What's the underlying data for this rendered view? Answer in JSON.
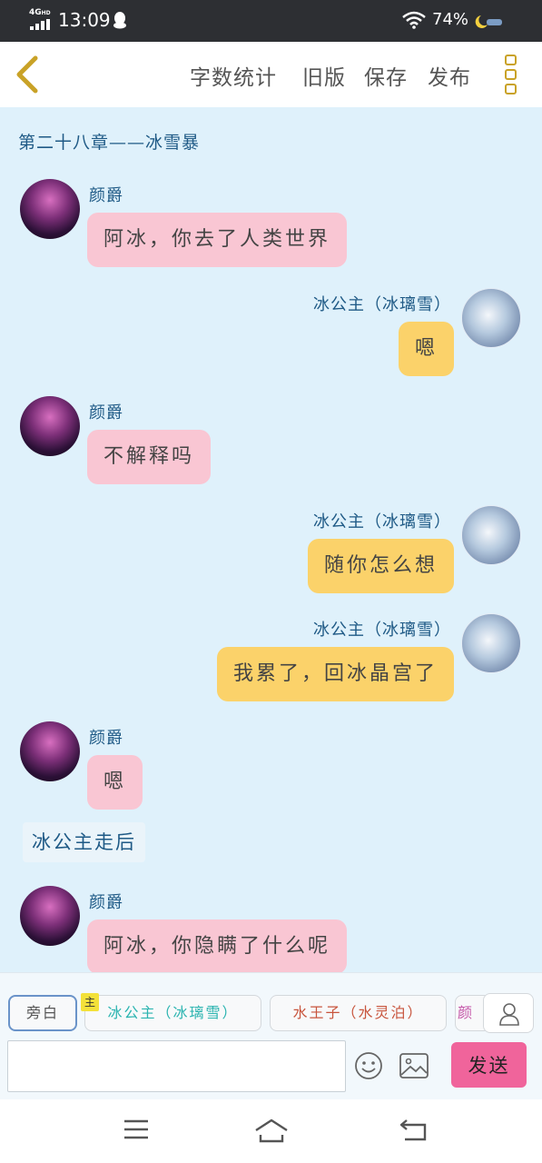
{
  "status_bar": {
    "network": "4G",
    "network_sup": "HD",
    "time": "13:09",
    "battery": "74%",
    "icons": [
      "signal-icon",
      "qq-icon",
      "wifi-icon",
      "moon-icon"
    ]
  },
  "header": {
    "links": [
      "字数统计",
      "旧版",
      "保存",
      "发布"
    ],
    "icons": [
      "back-arrow-icon",
      "more-menu-icon"
    ],
    "accent_color": "#c9a227"
  },
  "chat": {
    "chapter_title": "第二十八章——冰雪暴",
    "messages": [
      {
        "side": "left",
        "sender": "颜爵",
        "text": "阿冰，你去了人类世界"
      },
      {
        "side": "right",
        "sender": "冰公主（冰璃雪）",
        "text": "嗯"
      },
      {
        "side": "left",
        "sender": "颜爵",
        "text": "不解释吗"
      },
      {
        "side": "right",
        "sender": "冰公主（冰璃雪）",
        "text": "随你怎么想"
      },
      {
        "side": "right",
        "sender": "冰公主（冰璃雪）",
        "text": "我累了，回冰晶宫了"
      },
      {
        "side": "left",
        "sender": "颜爵",
        "text": "嗯"
      },
      {
        "side": "left",
        "sender": "颜爵",
        "text": "阿冰，你隐瞒了什么呢"
      }
    ],
    "narration": "冰公主走后",
    "colors": {
      "background": "#dff1fb",
      "left_bubble": "#f9c6d3",
      "right_bubble": "#fbd26a",
      "name_color": "#1f5a86"
    }
  },
  "composer": {
    "roles": {
      "narration": "旁白",
      "ice": "冰公主（冰璃雪）",
      "water": "水王子（水灵泊）",
      "partial": "颜"
    },
    "main_badge": "主",
    "input_value": "",
    "send_label": "发送",
    "send_color": "#f0649b",
    "icons": [
      "person-icon",
      "emoji-icon",
      "image-icon"
    ]
  },
  "system_nav": {
    "icons": [
      "menu-icon",
      "home-icon",
      "back-icon"
    ]
  }
}
